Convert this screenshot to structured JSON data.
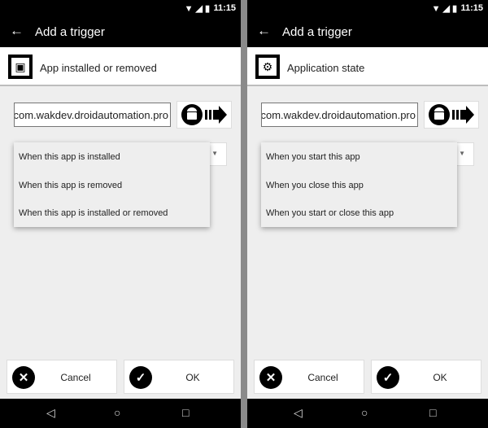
{
  "status_time": "11:15",
  "toolbar_title": "Add a trigger",
  "screens": [
    {
      "header": "App installed or removed",
      "header_icon": "package-icon",
      "package": "com.wakdev.droidautomation.pro",
      "options": [
        "When this app is installed",
        "When this app is removed",
        "When this app is installed or removed"
      ]
    },
    {
      "header": "Application state",
      "header_icon": "gears-icon",
      "package": "com.wakdev.droidautomation.pro",
      "options": [
        "When you start this app",
        "When you close this app",
        "When you start or close this app"
      ]
    }
  ],
  "buttons": {
    "cancel": "Cancel",
    "ok": "OK"
  }
}
